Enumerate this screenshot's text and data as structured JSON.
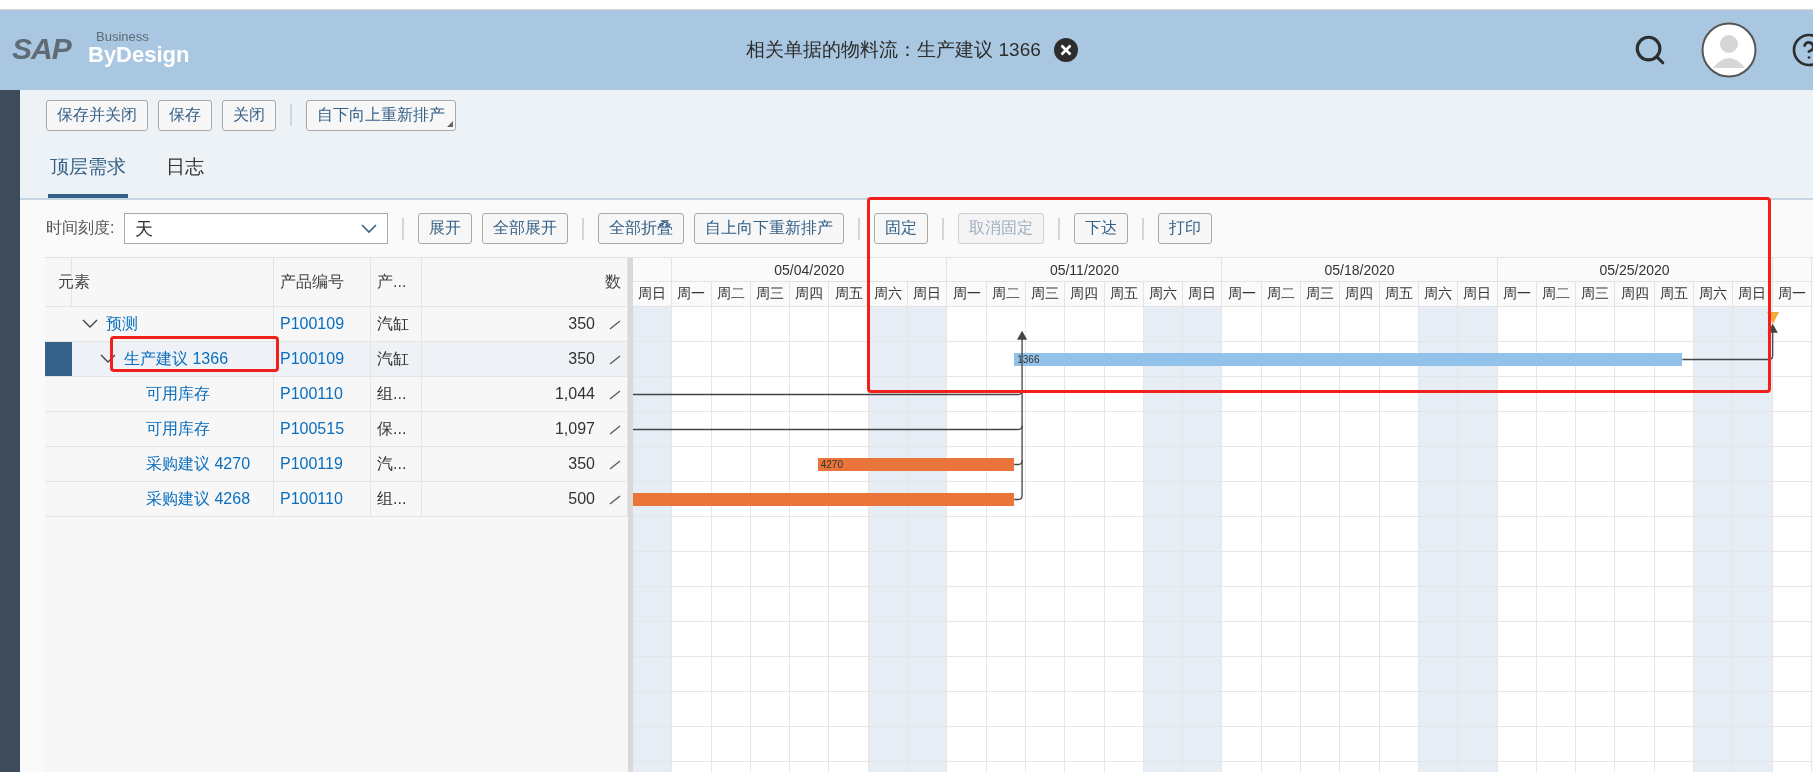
{
  "header": {
    "logo": {
      "brand": "SAP",
      "line1": "Business",
      "line2": "ByDesign"
    },
    "title": "相关单据的物料流：生产建议 1366"
  },
  "toolbar": [
    [
      {
        "label": "保存并关闭",
        "kind": "plain"
      },
      {
        "label": "保存",
        "kind": "plain"
      },
      {
        "label": "关闭",
        "kind": "plain"
      }
    ],
    [
      {
        "label": "自下向上重新排产",
        "kind": "menu"
      }
    ]
  ],
  "tabs": [
    {
      "label": "顶层需求",
      "selected": true
    },
    {
      "label": "日志",
      "selected": false
    }
  ],
  "time_scale": {
    "label": "时间刻度:",
    "value": "天"
  },
  "actions": [
    [
      {
        "label": "展开",
        "disabled": false
      },
      {
        "label": "全部展开",
        "disabled": false
      }
    ],
    [
      {
        "label": "全部折叠",
        "disabled": false
      },
      {
        "label": "自上向下重新排产",
        "disabled": false
      }
    ],
    [
      {
        "label": "固定",
        "disabled": false
      }
    ],
    [
      {
        "label": "取消固定",
        "disabled": true
      }
    ],
    [
      {
        "label": "下达",
        "disabled": false
      }
    ],
    [
      {
        "label": "打印",
        "disabled": false
      }
    ]
  ],
  "table": {
    "columns": [
      "元素",
      "产品编号",
      "产...",
      "数"
    ],
    "rows": [
      {
        "element": "预测",
        "product_id": "P100109",
        "product_name": "汽缸",
        "quantity": "350",
        "selected": false,
        "expanded": true,
        "bar": {
          "kind": "milestone",
          "color": "#f5a93b"
        },
        "children": [
          {
            "element": "生产建议 1366",
            "product_id": "P100109",
            "product_name": "汽缸",
            "quantity": "350",
            "selected": true,
            "expanded": true,
            "bar": {
              "kind": "bar",
              "label": "1366",
              "color": "#92c1ea"
            },
            "children": [
              {
                "element": "可用库存",
                "product_id": "P100110",
                "product_name": "组...",
                "quantity": "1,044",
                "selected": false
              },
              {
                "element": "可用库存",
                "product_id": "P100515",
                "product_name": "保...",
                "quantity": "1,097",
                "selected": false
              },
              {
                "element": "采购建议 4270",
                "product_id": "P100119",
                "product_name": "汽...",
                "quantity": "350",
                "selected": false,
                "bar": {
                  "kind": "bar",
                  "label": "4270",
                  "color": "#e9753b"
                }
              },
              {
                "element": "采购建议 4268",
                "product_id": "P100110",
                "product_name": "组...",
                "quantity": "500",
                "selected": false,
                "bar": {
                  "kind": "bar",
                  "color": "#e9753b"
                }
              }
            ]
          }
        ]
      }
    ]
  },
  "gantt": {
    "weeks": [
      "05/04/2020",
      "05/11/2020",
      "05/18/2020",
      "05/25/2020"
    ],
    "days": [
      {
        "label": "周日",
        "weekend": true
      },
      {
        "label": "周一",
        "weekend": false
      },
      {
        "label": "周二",
        "weekend": false
      },
      {
        "label": "周三",
        "weekend": false
      },
      {
        "label": "周四",
        "weekend": false
      },
      {
        "label": "周五",
        "weekend": false
      },
      {
        "label": "周六",
        "weekend": true
      },
      {
        "label": "周日",
        "weekend": true
      },
      {
        "label": "周一",
        "weekend": false
      },
      {
        "label": "周二",
        "weekend": false
      },
      {
        "label": "周三",
        "weekend": false
      },
      {
        "label": "周四",
        "weekend": false
      },
      {
        "label": "周五",
        "weekend": false
      },
      {
        "label": "周六",
        "weekend": true
      },
      {
        "label": "周日",
        "weekend": true
      },
      {
        "label": "周一",
        "weekend": false
      },
      {
        "label": "周二",
        "weekend": false
      },
      {
        "label": "周三",
        "weekend": false
      },
      {
        "label": "周四",
        "weekend": false
      },
      {
        "label": "周五",
        "weekend": false
      },
      {
        "label": "周六",
        "weekend": true
      },
      {
        "label": "周日",
        "weekend": true
      },
      {
        "label": "周一",
        "weekend": false
      },
      {
        "label": "周二",
        "weekend": false
      },
      {
        "label": "周三",
        "weekend": false
      },
      {
        "label": "周四",
        "weekend": false
      },
      {
        "label": "周五",
        "weekend": false
      },
      {
        "label": "周六",
        "weekend": true
      },
      {
        "label": "周日",
        "weekend": true
      },
      {
        "label": "周一",
        "weekend": false
      }
    ]
  }
}
